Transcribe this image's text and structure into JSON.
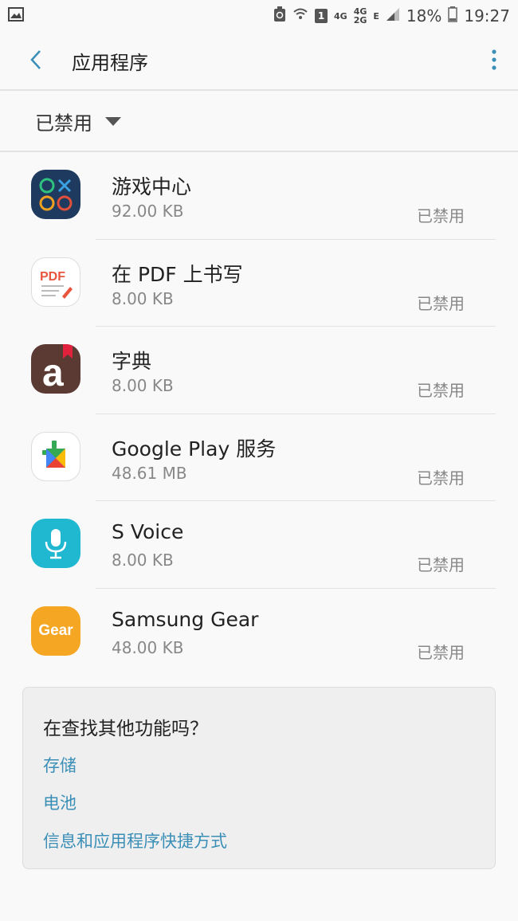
{
  "status_bar": {
    "net1": "4G",
    "net2": "4G",
    "net3": "2G",
    "sim": "1",
    "net4": "E",
    "battery": "18%",
    "time": "19:27"
  },
  "app_bar": {
    "title": "应用程序"
  },
  "filter": {
    "label": "已禁用"
  },
  "apps": [
    {
      "name": "游戏中心",
      "size": "92.00 KB",
      "state": "已禁用"
    },
    {
      "name": "在 PDF 上书写",
      "size": "8.00 KB",
      "state": "已禁用"
    },
    {
      "name": "字典",
      "size": "8.00 KB",
      "state": "已禁用"
    },
    {
      "name": "Google Play 服务",
      "size": "48.61 MB",
      "state": "已禁用"
    },
    {
      "name": "S Voice",
      "size": "8.00 KB",
      "state": "已禁用"
    },
    {
      "name": "Samsung Gear",
      "size": "48.00 KB",
      "state": "已禁用"
    }
  ],
  "icons": {
    "pdf_text": "PDF",
    "dict_letter": "a",
    "gear_text": "Gear"
  },
  "help_card": {
    "title": "在查找其他功能吗？",
    "links": [
      "存储",
      "电池",
      "信息和应用程序快捷方式"
    ]
  },
  "colors": {
    "accent": "#3b8fb7",
    "game_center_bg": "#1f3a5f",
    "dictionary_bg": "#5a3a32",
    "s_voice_bg": "#1fb8d0",
    "samsung_gear_bg": "#f5a623"
  }
}
